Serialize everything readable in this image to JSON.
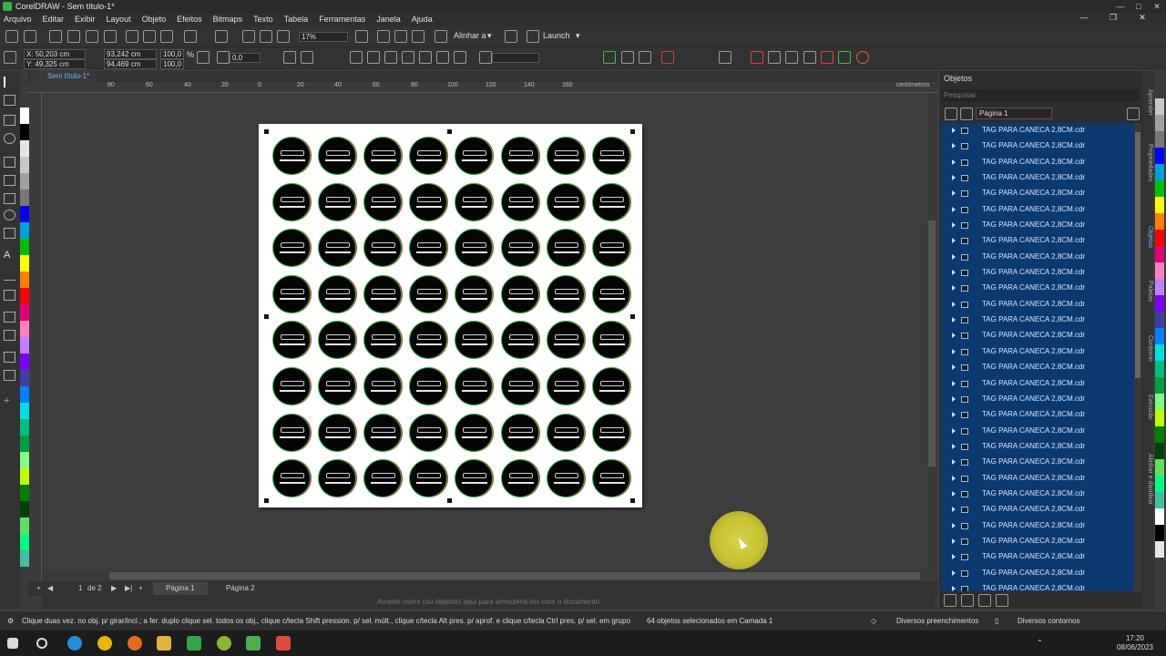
{
  "window": {
    "title": "CorelDRAW - Sem título-1*"
  },
  "menu": [
    "Arquivo",
    "Editar",
    "Exibir",
    "Layout",
    "Objeto",
    "Efeitos",
    "Bitmaps",
    "Texto",
    "Tabela",
    "Ferramentas",
    "Janela",
    "Ajuda"
  ],
  "toolbar": {
    "zoom": "17%",
    "align_label": "Alinhar a",
    "launch_label": "Launch"
  },
  "property_bar": {
    "x": "X: 50,203 cm",
    "y": "Y: 49,325 cm",
    "width": "93,242 cm",
    "height": "94,469 cm",
    "scale_w": "100,0",
    "scale_h": "100,0",
    "percent": "%",
    "rotation": "0,0"
  },
  "document_tab": "Sem título-1*",
  "ruler": {
    "unit": "centímetros",
    "h_ticks": [
      "80",
      "60",
      "40",
      "20",
      "0",
      "20",
      "40",
      "60",
      "80",
      "100",
      "120",
      "140",
      "160"
    ]
  },
  "canvas": {
    "rows": 8,
    "cols": 8
  },
  "pages": {
    "current": "1",
    "of": "de 2",
    "tabs": [
      "Página 1",
      "Página 2"
    ]
  },
  "drop_hint": "Arraste cores (ou objetos) aqui para armazená-los com o documento",
  "objects_docker": {
    "title": "Objetos",
    "search_placeholder": "Pesquisar",
    "page_selector": "Página 1",
    "items": [
      "TAG PARA CANECA 2,8CM.cdr",
      "TAG PARA CANECA 2,8CM.cdr",
      "TAG PARA CANECA 2,8CM.cdr",
      "TAG PARA CANECA 2,8CM.cdr",
      "TAG PARA CANECA 2,8CM.cdr",
      "TAG PARA CANECA 2,8CM.cdr",
      "TAG PARA CANECA 2,8CM.cdr",
      "TAG PARA CANECA 2,8CM.cdr",
      "TAG PARA CANECA 2,8CM.cdr",
      "TAG PARA CANECA 2,8CM.cdr",
      "TAG PARA CANECA 2,8CM.cdr",
      "TAG PARA CANECA 2,8CM.cdr",
      "TAG PARA CANECA 2,8CM.cdr",
      "TAG PARA CANECA 2,8CM.cdr",
      "TAG PARA CANECA 2,8CM.cdr",
      "TAG PARA CANECA 2,8CM.cdr",
      "TAG PARA CANECA 2,8CM.cdr",
      "TAG PARA CANECA 2,8CM.cdr",
      "TAG PARA CANECA 2,8CM.cdr",
      "TAG PARA CANECA 2,8CM.cdr",
      "TAG PARA CANECA 2,8CM.cdr",
      "TAG PARA CANECA 2,8CM.cdr",
      "TAG PARA CANECA 2,8CM.cdr",
      "TAG PARA CANECA 2,8CM.cdr",
      "TAG PARA CANECA 2,8CM.cdr",
      "TAG PARA CANECA 2,8CM.cdr",
      "TAG PARA CANECA 2,8CM.cdr",
      "TAG PARA CANECA 2,8CM.cdr",
      "TAG PARA CANECA 2,8CM.cdr",
      "TAG PARA CANECA 2,8CM.cdr"
    ]
  },
  "side_tabs": [
    "Aprender",
    "Propriedades",
    "Objetos",
    "Paletas",
    "Contorno",
    "Extrusão",
    "Alinhar e distribuir"
  ],
  "status": {
    "hint": "Clique duas vez. no obj. p/ girar/incl.; a fer. duplo clique sel. todos os obj., clique c/tecla Shift pression. p/ sel. múlt., clique c/tecla Alt pres. p/ aprof. e clique c/tecla Ctrl pres. p/ sel. em grupo",
    "selection": "64 objetos selecionados em Camada 1",
    "fill": "Diversos preenchimentos",
    "outline": "Diversos contornos"
  },
  "taskbar": {
    "time": "17:20",
    "date": "08/06/2023"
  },
  "palette_colors": [
    "#ffffff",
    "#000000",
    "#e5e5e5",
    "#c8c8c8",
    "#a0a0a0",
    "#787878",
    "#0000ff",
    "#00a0e0",
    "#00c000",
    "#ffff00",
    "#ff8000",
    "#ff0000",
    "#e0007a",
    "#ff80c0",
    "#c080ff",
    "#8000ff",
    "#4040a0",
    "#0080ff",
    "#00e0e0",
    "#00c080",
    "#00a040",
    "#80ff80",
    "#c0ff00",
    "#008000",
    "#004000",
    "#60e060",
    "#00ff80",
    "#40c0a0"
  ]
}
